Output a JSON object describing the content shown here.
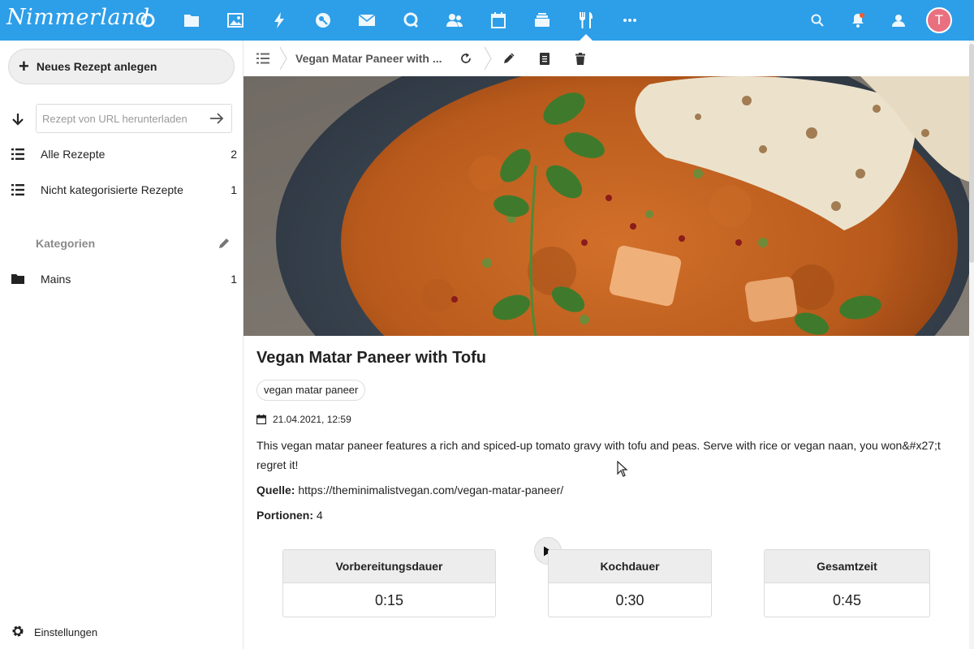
{
  "header": {
    "brand": "Nimmerland",
    "accent_color": "#2d9ee8",
    "apps": [
      {
        "name": "dashboard",
        "icon": "dashboard-circle-icon"
      },
      {
        "name": "files",
        "icon": "folder-icon"
      },
      {
        "name": "photos",
        "icon": "image-icon"
      },
      {
        "name": "activity",
        "icon": "lightning-icon"
      },
      {
        "name": "passwords",
        "icon": "key-icon"
      },
      {
        "name": "mail",
        "icon": "mail-icon"
      },
      {
        "name": "talk",
        "icon": "chat-icon"
      },
      {
        "name": "contacts",
        "icon": "contacts-icon"
      },
      {
        "name": "calendar",
        "icon": "calendar-icon"
      },
      {
        "name": "deck",
        "icon": "deck-icon"
      },
      {
        "name": "cookbook",
        "icon": "cutlery-icon",
        "active": true
      },
      {
        "name": "more",
        "icon": "more-dots-icon"
      }
    ],
    "right_icons": [
      "search-icon",
      "notifications-bell-icon",
      "contacts-menu-icon"
    ],
    "avatar_letter": "T",
    "avatar_color": "#e8707f"
  },
  "sidebar": {
    "new_recipe_label": "Neues Rezept anlegen",
    "url_placeholder": "Rezept von URL herunterladen",
    "items": [
      {
        "label": "Alle Rezepte",
        "count": "2",
        "icon": "list-icon"
      },
      {
        "label": "Nicht kategorisierte Rezepte",
        "count": "1",
        "icon": "list-icon"
      }
    ],
    "categories_caption": "Kategorien",
    "categories": [
      {
        "label": "Mains",
        "count": "1",
        "icon": "folder-icon"
      }
    ],
    "settings_label": "Einstellungen"
  },
  "toolbar": {
    "breadcrumb_title": "Vegan Matar Paneer with ...",
    "icons": [
      "toggle-sidebar-icon",
      "reload-icon",
      "edit-pencil-icon",
      "print-document-icon",
      "delete-trash-icon"
    ]
  },
  "recipe": {
    "title": "Vegan Matar Paneer with Tofu",
    "keyword": "vegan matar paneer",
    "date": "21.04.2021, 12:59",
    "description": "This vegan matar paneer features a rich and spiced-up tomato gravy with tofu and peas. Serve with rice or vegan naan, you won&#x27;t regret it!",
    "source_label": "Quelle:",
    "source_url": "https://theminimalistvegan.com/vegan-matar-paneer/",
    "servings_label": "Portionen:",
    "servings": "4"
  },
  "times": {
    "prep_label": "Vorbereitungsdauer",
    "prep_value": "0:15",
    "cook_label": "Kochdauer",
    "cook_value": "0:30",
    "total_label": "Gesamtzeit",
    "total_value": "0:45"
  }
}
